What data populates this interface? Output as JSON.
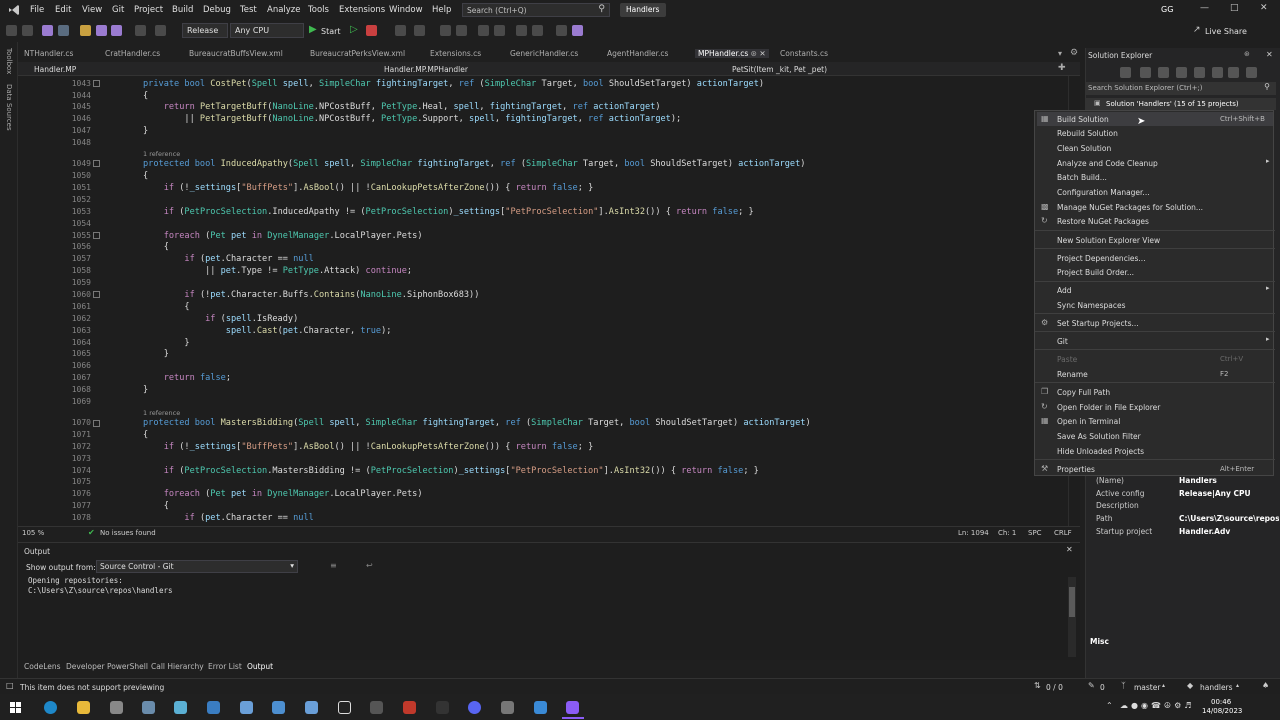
{
  "menu": {
    "items": [
      "File",
      "Edit",
      "View",
      "Git",
      "Project",
      "Build",
      "Debug",
      "Test",
      "Analyze",
      "Tools",
      "Extensions",
      "Window",
      "Help"
    ],
    "search_placeholder": "Search (Ctrl+Q)",
    "solution_name": "Handlers",
    "user_initials": "GG",
    "live_share": "Live Share"
  },
  "toolbar": {
    "config": "Release",
    "platform": "Any CPU",
    "start": "Start"
  },
  "left_tools": {
    "toolbox": "Toolbox",
    "data_sources": "Data Sources"
  },
  "tabs": [
    {
      "label": "NTHandler.cs"
    },
    {
      "label": "CratHandler.cs"
    },
    {
      "label": "BureaucratBuffsView.xml"
    },
    {
      "label": "BureaucratPerksView.xml"
    },
    {
      "label": "Extensions.cs"
    },
    {
      "label": "GenericHandler.cs"
    },
    {
      "label": "AgentHandler.cs"
    },
    {
      "label": "MPHandler.cs"
    },
    {
      "label": "Constants.cs"
    }
  ],
  "navbar": {
    "project": "Handler.MP",
    "type": "Handler.MP.MPHandler",
    "member": "PetSit(Item _kit, Pet _pet)"
  },
  "editor": {
    "lines": [
      "1043",
      "1044",
      "1045",
      "1046",
      "1047",
      "1048",
      "1049",
      "1050",
      "1051",
      "1052",
      "1053",
      "1054",
      "1055",
      "1056",
      "1057",
      "1058",
      "1059",
      "1060",
      "1061",
      "1062",
      "1063",
      "1064",
      "1065",
      "1066",
      "1067",
      "1068",
      "1069",
      "1070",
      "1071",
      "1072",
      "1073",
      "1074",
      "1075",
      "1076",
      "1077",
      "1078"
    ],
    "ref1": "1 reference",
    "ref2": "1 reference"
  },
  "editor_status": {
    "zoom": "105 %",
    "issues": "No issues found",
    "position": "Ln: 1094",
    "column": "Ch: 1",
    "spacing": "SPC",
    "eol": "CRLF"
  },
  "output": {
    "title": "Output",
    "show_from_label": "Show output from:",
    "source": "Source Control - Git",
    "log": [
      "Opening repositories:",
      "C:\\Users\\Z\\source\\repos\\handlers"
    ]
  },
  "bottom_tabs": [
    "CodeLens",
    "Developer PowerShell",
    "Call Hierarchy",
    "Error List",
    "Output"
  ],
  "status": {
    "message": "This item does not support previewing",
    "git_counts": "0 / 0",
    "changes": "0",
    "branch": "master",
    "repo": "handlers"
  },
  "solution_explorer": {
    "title": "Solution Explorer",
    "search_placeholder": "Search Solution Explorer (Ctrl+;)",
    "root": "Solution 'Handlers' (15 of 15 projects)"
  },
  "context_menu": [
    {
      "label": "Build Solution",
      "shortcut": "Ctrl+Shift+B",
      "highlight": true
    },
    {
      "label": "Rebuild Solution"
    },
    {
      "label": "Clean Solution"
    },
    {
      "label": "Analyze and Code Cleanup",
      "submenu": true
    },
    {
      "label": "Batch Build..."
    },
    {
      "label": "Configuration Manager..."
    },
    {
      "label": "Manage NuGet Packages for Solution..."
    },
    {
      "label": "Restore NuGet Packages"
    },
    {
      "label": "New Solution Explorer View"
    },
    {
      "label": "Project Dependencies..."
    },
    {
      "label": "Project Build Order..."
    },
    {
      "label": "Add",
      "submenu": true
    },
    {
      "label": "Sync Namespaces"
    },
    {
      "label": "Set Startup Projects..."
    },
    {
      "label": "Git",
      "submenu": true
    },
    {
      "label": "Paste",
      "shortcut": "Ctrl+V",
      "disabled": true
    },
    {
      "label": "Rename",
      "shortcut": "F2"
    },
    {
      "label": "Copy Full Path"
    },
    {
      "label": "Open Folder in File Explorer"
    },
    {
      "label": "Open in Terminal"
    },
    {
      "label": "Save As Solution Filter"
    },
    {
      "label": "Hide Unloaded Projects"
    },
    {
      "label": "Properties",
      "shortcut": "Alt+Enter"
    }
  ],
  "properties": [
    {
      "key": "(Name)",
      "value": "Handlers"
    },
    {
      "key": "Active config",
      "value": "Release|Any CPU"
    },
    {
      "key": "Description",
      "value": ""
    },
    {
      "key": "Path",
      "value": "C:\\Users\\Z\\source\\repos\\"
    },
    {
      "key": "Startup project",
      "value": "Handler.Adv"
    }
  ],
  "properties_category": "Misc",
  "clock": {
    "time": "00:46",
    "date": "14/08/2023"
  },
  "colors": {
    "accent": "#8b5cf6",
    "background": "#1e1e1e",
    "keyword": "#569cd6",
    "type": "#4ec9b0"
  }
}
